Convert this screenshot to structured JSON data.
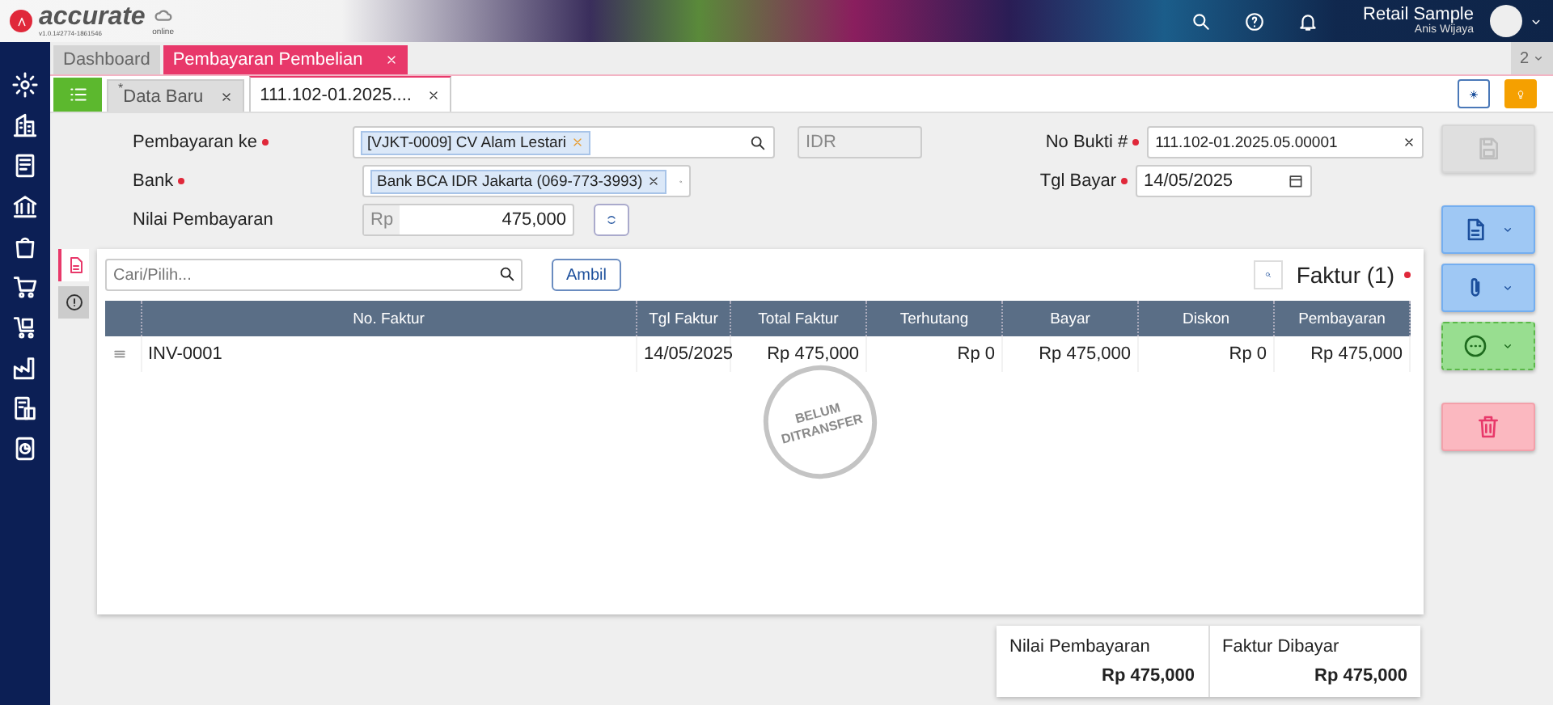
{
  "header": {
    "brand": "accurate",
    "version": "v1.0.1#2774-1861546",
    "cloud_label": "online",
    "company": "Retail Sample",
    "user": "Anis Wijaya"
  },
  "top_tabs": [
    {
      "label": "Dashboard",
      "selected": false,
      "closable": false
    },
    {
      "label": "Pembayaran Pembelian",
      "selected": true,
      "closable": true
    }
  ],
  "tab_count": "2",
  "doc_tabs": [
    {
      "label": "Data Baru",
      "prefix": "*",
      "selected": false
    },
    {
      "label": "111.102-01.2025....",
      "selected": true
    }
  ],
  "form": {
    "pay_to": {
      "label": "Pembayaran ke",
      "required": true,
      "value": "[VJKT-0009] CV Alam Lestari"
    },
    "currency": "IDR",
    "no_bukti": {
      "label": "No Bukti #",
      "required": true,
      "value": "111.102-01.2025.05.00001"
    },
    "bank": {
      "label": "Bank",
      "required": true,
      "value": "Bank BCA IDR Jakarta (069-773-3993)"
    },
    "tgl_bayar": {
      "label": "Tgl Bayar",
      "required": true,
      "value": "14/05/2025"
    },
    "nilai": {
      "label": "Nilai Pembayaran",
      "prefix": "Rp",
      "value": "475,000"
    }
  },
  "side_tabs": [
    {
      "kind": "document",
      "selected": true
    },
    {
      "kind": "info",
      "selected": false
    }
  ],
  "card": {
    "search": {
      "placeholder": "Cari/Pilih..."
    },
    "fetch_button": "Ambil",
    "title": "Faktur (1)",
    "title_required": true,
    "columns": [
      "No. Faktur",
      "Tgl Faktur",
      "Total Faktur",
      "Terhutang",
      "Bayar",
      "Diskon",
      "Pembayaran"
    ],
    "rows": [
      {
        "cells": [
          "INV-0001",
          "14/05/2025",
          "Rp 475,000",
          "Rp 0",
          "Rp 475,000",
          "Rp 0",
          "Rp 475,000"
        ]
      }
    ],
    "stamp": [
      "BELUM",
      "DITRANSFER"
    ]
  },
  "summary": [
    {
      "label": "Nilai Pembayaran",
      "value": "Rp 475,000"
    },
    {
      "label": "Faktur Dibayar",
      "value": "Rp 475,000"
    }
  ],
  "actions": [
    {
      "kind": "save",
      "disabled": true
    },
    {
      "kind": "print",
      "disabled": false
    },
    {
      "kind": "attach",
      "disabled": false
    },
    {
      "kind": "more",
      "disabled": false
    },
    {
      "kind": "delete",
      "disabled": false
    }
  ]
}
